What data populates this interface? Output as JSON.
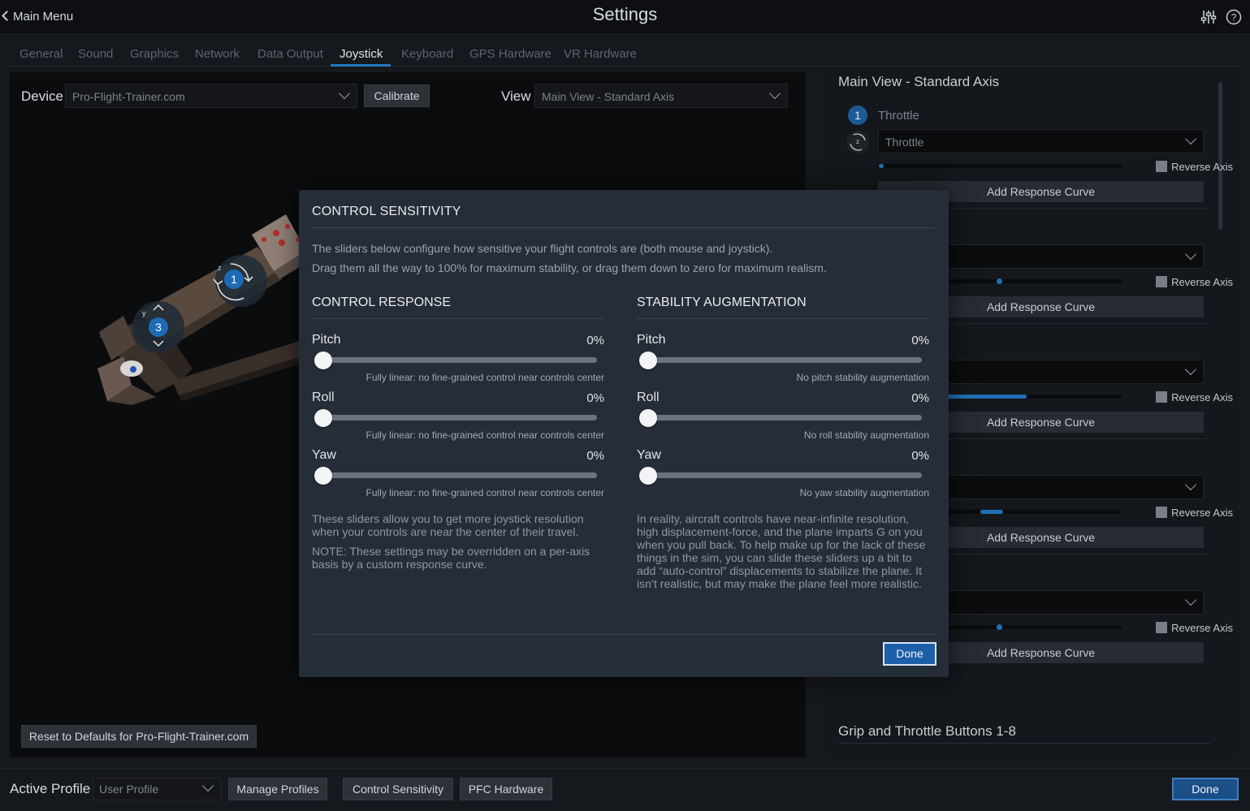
{
  "header": {
    "back_label": "Main Menu",
    "title": "Settings",
    "mixer_icon": "sliders-icon",
    "help_icon": "help-icon"
  },
  "tabs": [
    "General",
    "Sound",
    "Graphics",
    "Network",
    "Data Output",
    "Joystick",
    "Keyboard",
    "GPS Hardware",
    "VR Hardware"
  ],
  "active_tab": "Joystick",
  "device": {
    "label": "Device",
    "value": "Pro-Flight-Trainer.com",
    "calibrate": "Calibrate",
    "view_label": "View",
    "view_value": "Main View - Standard Axis",
    "reset": "Reset to Defaults for Pro-Flight-Trainer.com",
    "badge_z": "z",
    "badge_1": "1",
    "badge_y": "y",
    "badge_3": "3"
  },
  "right": {
    "section_title": "Main View - Standard Axis",
    "axis_num": "1",
    "axis_name": "Throttle",
    "axis_value": "Throttle",
    "rotate_letter": "z",
    "reverse_label": "Reverse Axis",
    "add_curve": "Add Response Curve",
    "axis_levels": [
      0.02,
      0.5,
      0.35,
      0.12,
      0.5
    ],
    "buttons_title": "Grip and Throttle Buttons 1-8"
  },
  "bottom": {
    "active_profile_label": "Active Profile",
    "profile_value": "User Profile",
    "manage_profiles": "Manage Profiles",
    "control_sensitivity": "Control Sensitivity",
    "pfc_hardware": "PFC Hardware",
    "done": "Done"
  },
  "modal": {
    "title": "CONTROL SENSITIVITY",
    "intro1": "The sliders below configure how sensitive your flight controls are (both mouse and joystick).",
    "intro2": "Drag them all the way to 100% for maximum stability, or drag them down to zero for maximum realism.",
    "response": {
      "heading": "CONTROL RESPONSE",
      "sliders": [
        {
          "label": "Pitch",
          "value": "0%",
          "desc": "Fully linear: no fine-grained control near controls center"
        },
        {
          "label": "Roll",
          "value": "0%",
          "desc": "Fully linear: no fine-grained control near controls center"
        },
        {
          "label": "Yaw",
          "value": "0%",
          "desc": "Fully linear: no fine-grained control near controls center"
        }
      ],
      "para1": "These sliders allow you to get more joystick resolution when your controls are near the center of their travel.",
      "para2": "NOTE: These settings may be overridden on a per-axis basis by a custom response curve."
    },
    "stability": {
      "heading": "STABILITY AUGMENTATION",
      "sliders": [
        {
          "label": "Pitch",
          "value": "0%",
          "desc": "No pitch stability augmentation"
        },
        {
          "label": "Roll",
          "value": "0%",
          "desc": "No roll stability augmentation"
        },
        {
          "label": "Yaw",
          "value": "0%",
          "desc": "No yaw stability augmentation"
        }
      ],
      "para": "In reality, aircraft controls have near-infinite resolution, high displacement-force, and the plane imparts G on you when you pull back. To help make up for the lack of these things in the sim, you can slide these sliders up a bit to add “auto-control” displacements to stabilize the plane. It isn’t realistic, but may make the plane feel more realistic."
    },
    "done": "Done"
  },
  "colors": {
    "accent": "#1f6fb4",
    "modal_bg": "#252d38",
    "done_bg": "#1c5fa8"
  }
}
